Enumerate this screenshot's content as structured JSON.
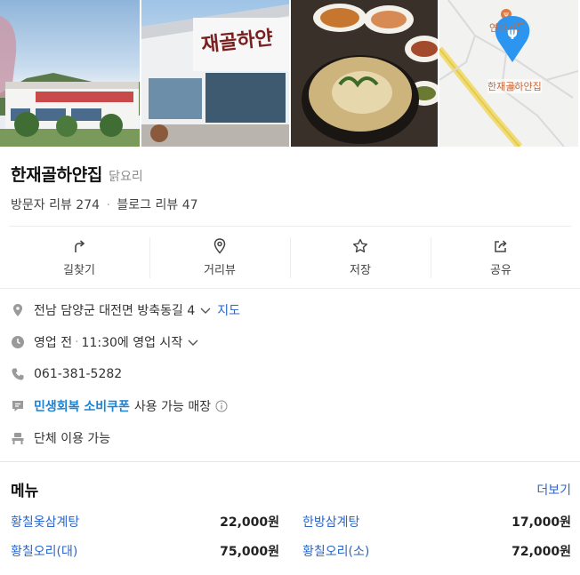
{
  "map": {
    "poi_label": "연화가든",
    "pin_label": "한재골하얀집"
  },
  "place": {
    "name": "한재골하얀집",
    "category": "닭요리",
    "visitor_reviews": "방문자 리뷰 274",
    "separator": "·",
    "blog_reviews": "블로그 리뷰 47"
  },
  "actions": [
    {
      "label": "길찾기",
      "icon": "directions-icon"
    },
    {
      "label": "거리뷰",
      "icon": "street-view-pin-icon"
    },
    {
      "label": "저장",
      "icon": "star-icon"
    },
    {
      "label": "공유",
      "icon": "share-icon"
    }
  ],
  "info": {
    "address": "전남 담양군 대전면 방축동길 4",
    "map_link": "지도",
    "status": "영업 전",
    "hours": "11:30에 영업 시작",
    "phone": "061-381-5282",
    "coupon": "민생회복 소비쿠폰",
    "coupon_suffix": "사용 가능 매장",
    "group": "단체 이용 가능"
  },
  "menu": {
    "title": "메뉴",
    "more": "더보기",
    "items": [
      {
        "name": "황칠옻삼계탕",
        "price": "22,000원"
      },
      {
        "name": "한방삼계탕",
        "price": "17,000원"
      },
      {
        "name": "황칠오리(대)",
        "price": "75,000원"
      },
      {
        "name": "황칠오리(소)",
        "price": "72,000원"
      }
    ]
  },
  "colors": {
    "accent_blue": "#2a66c9",
    "coupon_blue": "#1a83d6",
    "map_pin": "#2b95f0",
    "poi_orange": "#e07a3f"
  }
}
